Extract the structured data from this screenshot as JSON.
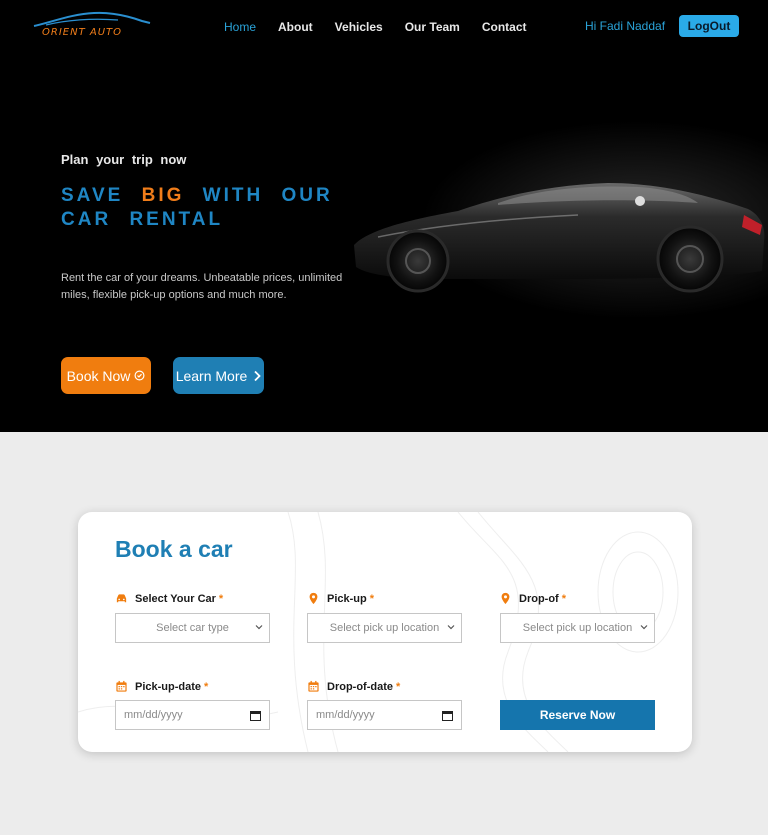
{
  "brand": {
    "name": "ORIENT AUTO",
    "accent": "#f07d1a",
    "primary": "#1f7fb4",
    "logo_icon": "car-silhouette-logo-icon"
  },
  "nav": {
    "items": [
      {
        "label": "Home",
        "active": true
      },
      {
        "label": "About"
      },
      {
        "label": "Vehicles"
      },
      {
        "label": "Our Team"
      },
      {
        "label": "Contact"
      }
    ],
    "greeting": "Hi Fadi Naddaf",
    "logout_label": "LogOut"
  },
  "hero": {
    "eyebrow": "Plan your trip now",
    "headline_before": "SAVE ",
    "headline_highlight": "BIG",
    "headline_after": " WITH OUR CAR RENTAL",
    "description": "Rent the car of your dreams. Unbeatable prices, unlimited miles, flexible pick-up options and much more.",
    "book_label": "Book Now",
    "book_icon": "circle-check-icon",
    "learn_label": "Learn More",
    "learn_icon": "chevron-right-icon"
  },
  "booking": {
    "title": "Book a car",
    "car": {
      "label": "Select Your Car",
      "required": "*",
      "icon": "car-icon",
      "placeholder": "Select car type"
    },
    "pickup": {
      "label": "Pick-up",
      "required": "*",
      "icon": "location-pin-icon",
      "placeholder": "Select pick up location"
    },
    "dropoff": {
      "label": "Drop-of",
      "required": "*",
      "icon": "location-pin-icon",
      "placeholder": "Select pick up location"
    },
    "pickup_date": {
      "label": "Pick-up-date",
      "required": "*",
      "icon": "calendar-icon",
      "placeholder": "mm/dd/yyyy"
    },
    "dropoff_date": {
      "label": "Drop-of-date",
      "required": "*",
      "icon": "calendar-icon",
      "placeholder": "mm/dd/yyyy"
    },
    "reserve_label": "Reserve Now"
  }
}
